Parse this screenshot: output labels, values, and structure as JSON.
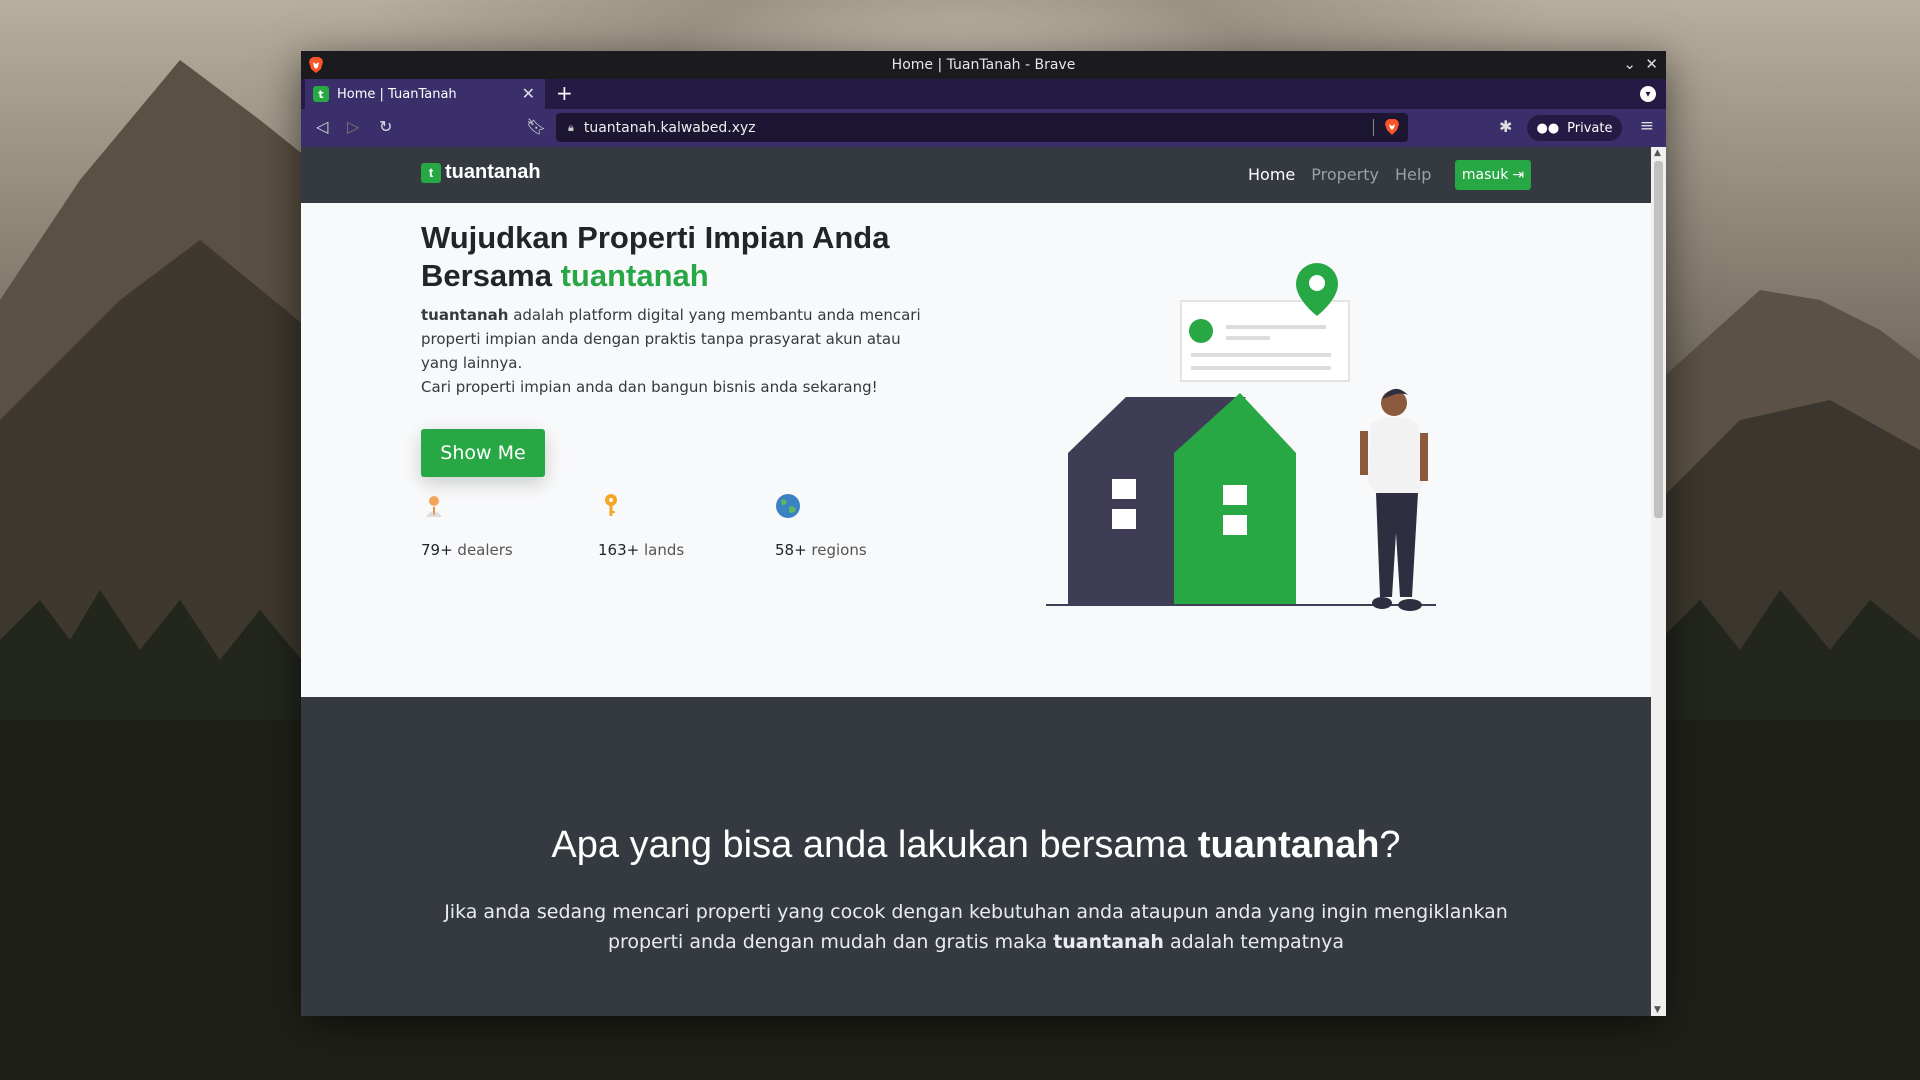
{
  "window": {
    "title": "Home | TuanTanah - Brave",
    "tab_title": "Home | TuanTanah",
    "url": "tuantanah.kalwabed.xyz",
    "private_label": "Private"
  },
  "site": {
    "brand": "tuantanah",
    "nav": [
      {
        "label": "Home"
      },
      {
        "label": "Property"
      },
      {
        "label": "Help"
      }
    ],
    "login_label": "masuk"
  },
  "hero": {
    "title_line1": "Wujudkan Properti Impian Anda",
    "title_line2_prefix": "Bersama ",
    "title_accent": "tuantanah",
    "desc_brand": "tuantanah",
    "desc_text": " adalah platform digital yang membantu anda mencari properti impian anda dengan praktis tanpa prasyarat akun atau yang lainnya.",
    "desc_line2": "Cari properti impian anda dan bangun bisnis anda sekarang!",
    "cta_label": "Show Me",
    "stats": [
      {
        "value": "79+",
        "label": " dealers",
        "icon": "dealer-icon"
      },
      {
        "value": "163+",
        "label": " lands",
        "icon": "key-icon"
      },
      {
        "value": "58+",
        "label": " regions",
        "icon": "globe-icon"
      }
    ]
  },
  "features": {
    "title_prefix": "Apa yang bisa anda lakukan bersama ",
    "title_brand": "tuantanah",
    "title_suffix": "?",
    "desc_prefix": "Jika anda sedang mencari properti yang cocok dengan kebutuhan anda ataupun anda yang ingin mengiklankan properti anda dengan mudah dan gratis maka ",
    "desc_brand": "tuantanah",
    "desc_suffix": " adalah tempatnya"
  },
  "colors": {
    "accent": "#28a745",
    "navbar": "#343a40",
    "browser_purple": "#3a2f6a"
  }
}
